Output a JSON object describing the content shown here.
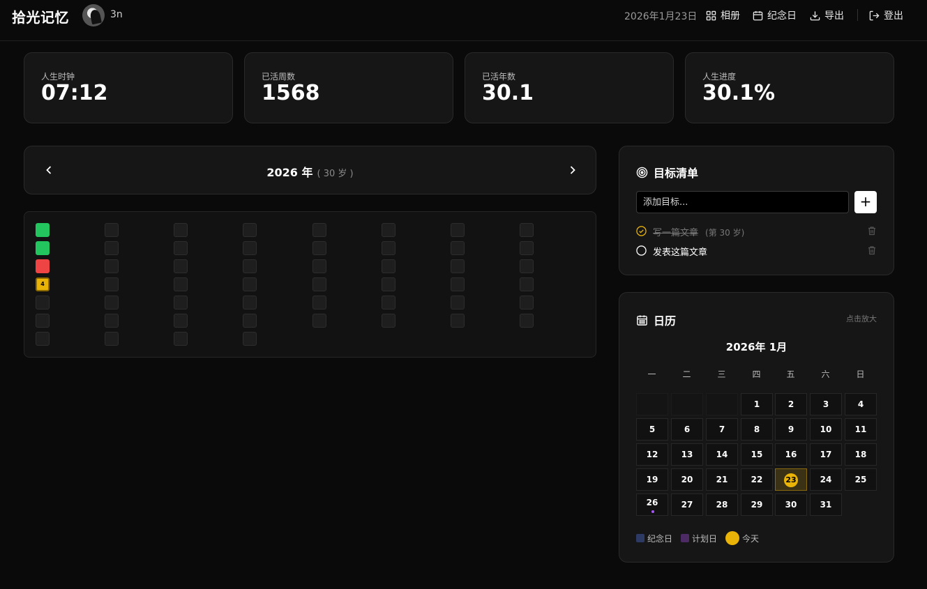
{
  "header": {
    "brand": "拾光记忆",
    "username": "3n",
    "date": "2026年1月23日",
    "nav": [
      {
        "label": "相册",
        "icon": "grid-icon"
      },
      {
        "label": "纪念日",
        "icon": "calendar-icon"
      },
      {
        "label": "导出",
        "icon": "download-icon"
      },
      {
        "label": "登出",
        "icon": "logout-icon"
      }
    ]
  },
  "stats": [
    {
      "label": "人生时钟",
      "value": "07:12"
    },
    {
      "label": "已活周数",
      "value": "1568"
    },
    {
      "label": "已活年数",
      "value": "30.1"
    },
    {
      "label": "人生进度",
      "value": "30.1%"
    }
  ],
  "year_nav": {
    "year": "2026 年",
    "age": "( 30 岁 )"
  },
  "weeks": {
    "current_week_label": "4",
    "total_weeks": 52,
    "status_by_index": {
      "0": "green",
      "1": "green",
      "2": "red",
      "3": "current"
    },
    "colors": {
      "green": "#22c55e",
      "red": "#ef4444",
      "current": "#eab308",
      "empty": "#1e1e1e"
    }
  },
  "goals": {
    "title": "目标清单",
    "input_placeholder": "添加目标...",
    "add_label": "+",
    "items": [
      {
        "text": "写一篇文章",
        "age": "(第 30 岁)",
        "done": true
      },
      {
        "text": "发表这篇文章",
        "age": "",
        "done": false
      }
    ]
  },
  "calendar": {
    "title": "日历",
    "zoom_hint": "点击放大",
    "month": "2026年 1月",
    "weekdays": [
      "一",
      "二",
      "三",
      "四",
      "五",
      "六",
      "日"
    ],
    "leading_blanks": 3,
    "days": [
      "1",
      "2",
      "3",
      "4",
      "5",
      "6",
      "7",
      "8",
      "9",
      "10",
      "11",
      "12",
      "13",
      "14",
      "15",
      "16",
      "17",
      "18",
      "19",
      "20",
      "21",
      "22",
      "23",
      "24",
      "25",
      "26",
      "27",
      "28",
      "29",
      "30",
      "31"
    ],
    "today": "23",
    "plan_days": [
      "26"
    ],
    "legend": [
      {
        "label": "纪念日",
        "color": "#2d3a63"
      },
      {
        "label": "计划日",
        "color": "#4c2a63"
      },
      {
        "label": "今天",
        "color": "#eab308"
      }
    ]
  }
}
